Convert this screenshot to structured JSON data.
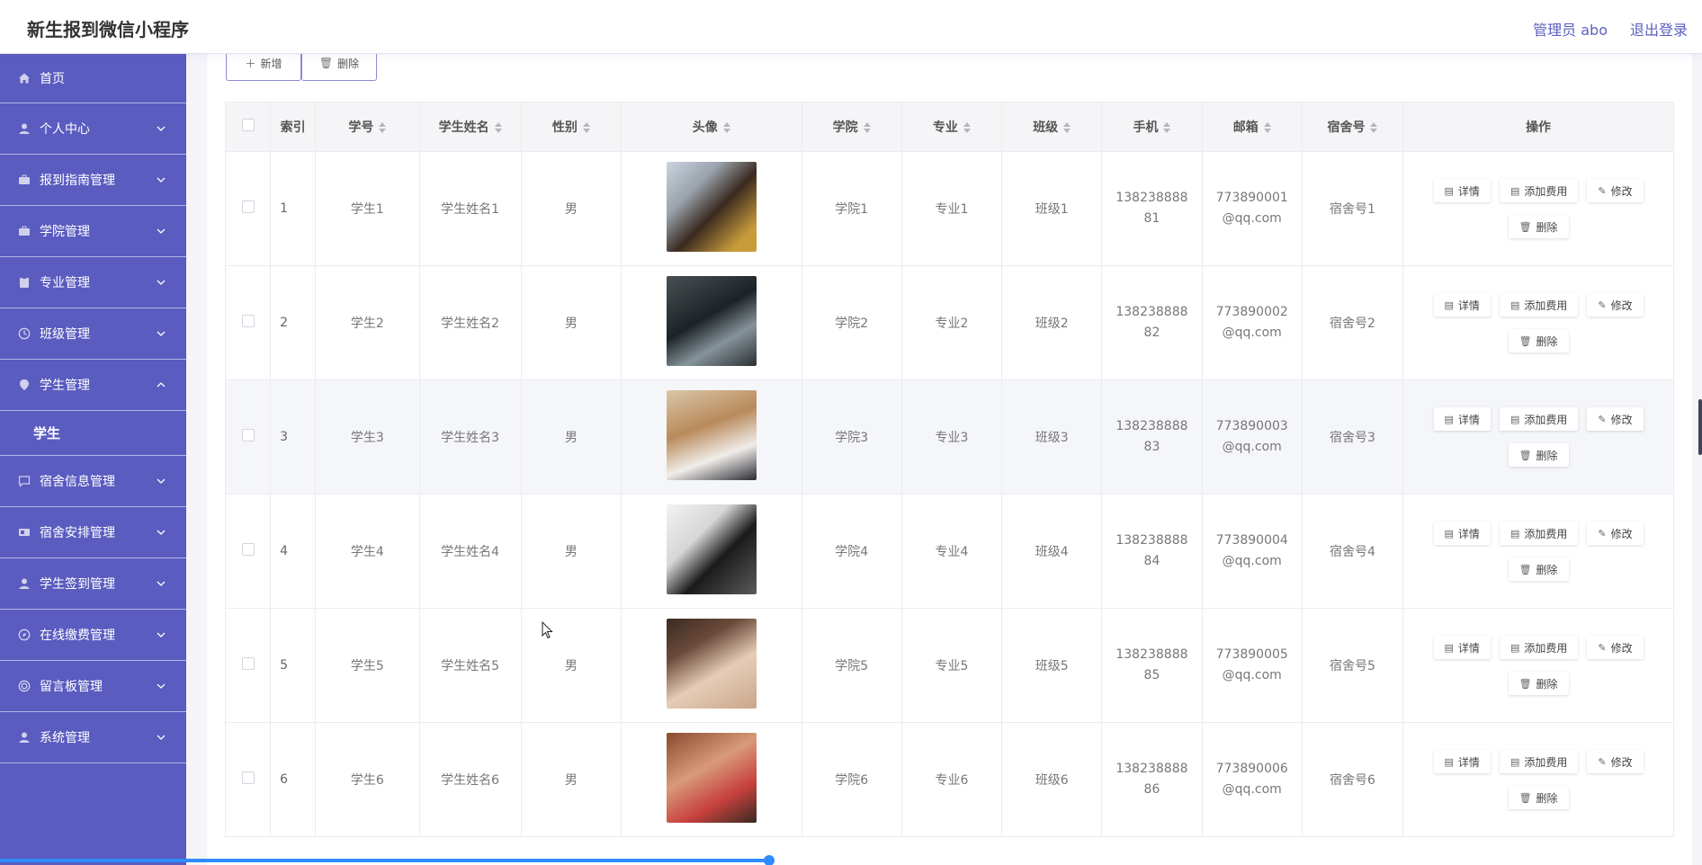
{
  "app": {
    "title": "新生报到微信小程序",
    "admin": "管理员 abo",
    "logout": "退出登录"
  },
  "sidebar": {
    "home": "首页",
    "items": [
      {
        "label": "个人中心",
        "icon": "user-icon",
        "expanded": false
      },
      {
        "label": "报到指南管理",
        "icon": "briefcase-icon",
        "expanded": false
      },
      {
        "label": "学院管理",
        "icon": "briefcase-icon",
        "expanded": false
      },
      {
        "label": "专业管理",
        "icon": "clipboard-icon",
        "expanded": false
      },
      {
        "label": "班级管理",
        "icon": "clock-icon",
        "expanded": false
      },
      {
        "label": "学生管理",
        "icon": "location-icon",
        "expanded": true
      }
    ],
    "sub": "学生",
    "items2": [
      {
        "label": "宿舍信息管理",
        "icon": "chat-icon"
      },
      {
        "label": "宿舍安排管理",
        "icon": "card-icon"
      },
      {
        "label": "学生签到管理",
        "icon": "user-icon"
      },
      {
        "label": "在线缴费管理",
        "icon": "compass-icon"
      },
      {
        "label": "留言板管理",
        "icon": "target-icon"
      },
      {
        "label": "系统管理",
        "icon": "user-icon"
      }
    ]
  },
  "toolbar": {
    "add": "新增",
    "delete": "删除"
  },
  "table": {
    "headers": [
      "索引",
      "学号",
      "学生姓名",
      "性别",
      "头像",
      "学院",
      "专业",
      "班级",
      "手机",
      "邮箱",
      "宿舍号",
      "操作"
    ],
    "actions": {
      "detail": "详情",
      "fee": "添加费用",
      "edit": "修改",
      "delete": "删除"
    },
    "rows": [
      {
        "idx": "1",
        "no": "学生1",
        "name": "学生姓名1",
        "gender": "男",
        "college": "学院1",
        "major": "专业1",
        "cls": "班级1",
        "phone": "13823888881",
        "email": "773890001@qq.com",
        "dorm": "宿舍号1"
      },
      {
        "idx": "2",
        "no": "学生2",
        "name": "学生姓名2",
        "gender": "男",
        "college": "学院2",
        "major": "专业2",
        "cls": "班级2",
        "phone": "13823888882",
        "email": "773890002@qq.com",
        "dorm": "宿舍号2"
      },
      {
        "idx": "3",
        "no": "学生3",
        "name": "学生姓名3",
        "gender": "男",
        "college": "学院3",
        "major": "专业3",
        "cls": "班级3",
        "phone": "13823888883",
        "email": "773890003@qq.com",
        "dorm": "宿舍号3"
      },
      {
        "idx": "4",
        "no": "学生4",
        "name": "学生姓名4",
        "gender": "男",
        "college": "学院4",
        "major": "专业4",
        "cls": "班级4",
        "phone": "13823888884",
        "email": "773890004@qq.com",
        "dorm": "宿舍号4"
      },
      {
        "idx": "5",
        "no": "学生5",
        "name": "学生姓名5",
        "gender": "男",
        "college": "学院5",
        "major": "专业5",
        "cls": "班级5",
        "phone": "13823888885",
        "email": "773890005@qq.com",
        "dorm": "宿舍号5"
      },
      {
        "idx": "6",
        "no": "学生6",
        "name": "学生姓名6",
        "gender": "男",
        "college": "学院6",
        "major": "专业6",
        "cls": "班级6",
        "phone": "13823888886",
        "email": "773890006@qq.com",
        "dorm": "宿舍号6"
      }
    ]
  },
  "colors": {
    "sidebar": "#5a5cc0",
    "accent": "#5c5fc0",
    "progress": "#2f8cff"
  }
}
